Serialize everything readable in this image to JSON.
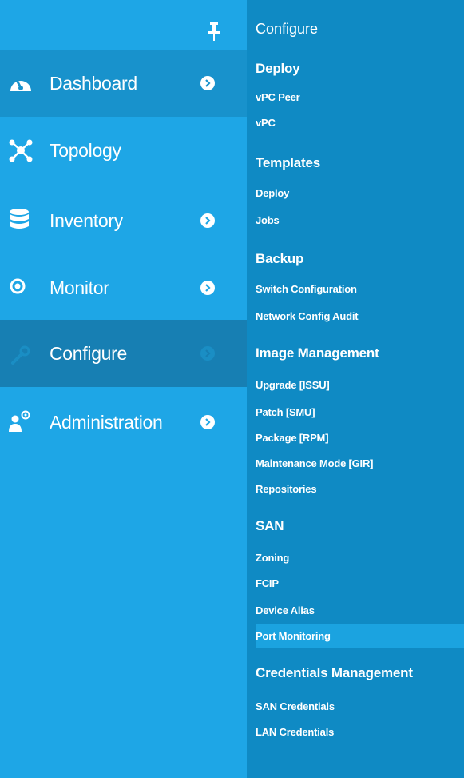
{
  "sidebar": {
    "pin_icon": "pin-icon",
    "items": [
      {
        "id": "dashboard",
        "label": "Dashboard",
        "icon": "dashboard-icon",
        "has_chevron": true
      },
      {
        "id": "topology",
        "label": "Topology",
        "icon": "topology-icon",
        "has_chevron": false
      },
      {
        "id": "inventory",
        "label": "Inventory",
        "icon": "database-icon",
        "has_chevron": true
      },
      {
        "id": "monitor",
        "label": "Monitor",
        "icon": "eye-icon",
        "has_chevron": true
      },
      {
        "id": "configure",
        "label": "Configure",
        "icon": "wrench-icon",
        "has_chevron": true,
        "active": true
      },
      {
        "id": "administration",
        "label": "Administration",
        "icon": "admin-user-gear-icon",
        "has_chevron": true
      }
    ]
  },
  "flyout": {
    "title": "Configure",
    "sections": [
      {
        "title": "Deploy",
        "links": [
          "vPC Peer",
          "vPC"
        ]
      },
      {
        "title": "Templates",
        "links": [
          "Deploy",
          "Jobs"
        ]
      },
      {
        "title": "Backup",
        "links": [
          "Switch Configuration",
          "Network Config Audit"
        ]
      },
      {
        "title": "Image Management",
        "links": [
          "Upgrade [ISSU]",
          "Patch [SMU]",
          "Package [RPM]",
          "Maintenance Mode [GIR]",
          "Repositories"
        ]
      },
      {
        "title": "SAN",
        "links": [
          "Zoning",
          "FCIP",
          "Device Alias",
          "Port Monitoring"
        ]
      },
      {
        "title": "Credentials Management",
        "links": [
          "SAN Credentials",
          "LAN Credentials"
        ]
      }
    ],
    "highlighted_link": "Port Monitoring"
  },
  "colors": {
    "sidebar_bg": "#1ea6e6",
    "sidebar_active": "#177fb3",
    "sidebar_hover": "#1892cc",
    "flyout_bg": "#0f8ac4",
    "highlight": "#1ba3e0",
    "text": "#ffffff"
  }
}
